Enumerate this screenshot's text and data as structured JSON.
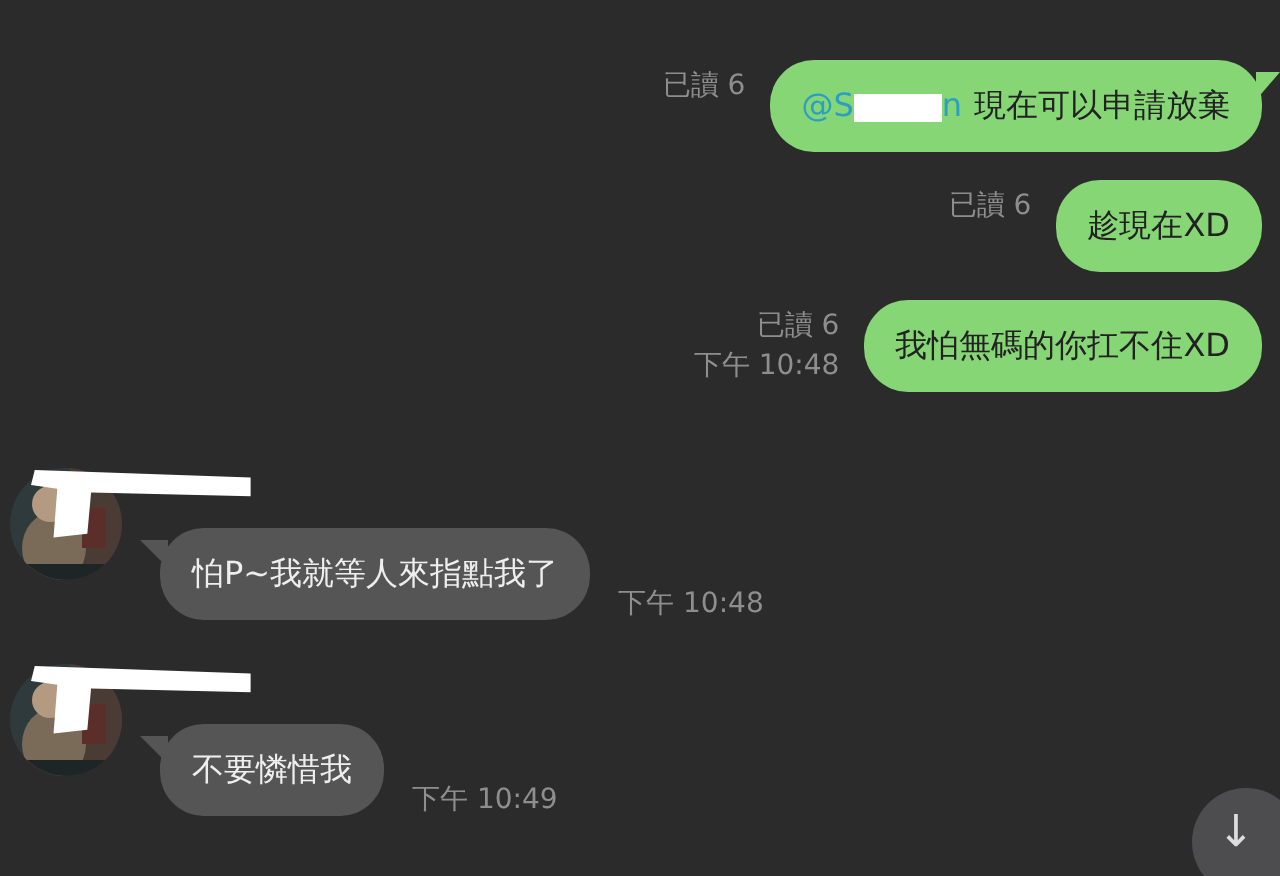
{
  "messages": [
    {
      "kind": "outgoing",
      "mention": [
        "@S",
        "n"
      ],
      "text": "現在可以申請放棄",
      "read": "已讀 6",
      "tail": true
    },
    {
      "kind": "outgoing",
      "text": "趁現在XD",
      "read": "已讀 6",
      "tail": false
    },
    {
      "kind": "outgoing",
      "text": "我怕無碼的你扛不住XD",
      "read": "已讀 6",
      "time": "下午 10:48",
      "tail": false
    },
    {
      "kind": "incoming",
      "text": "怕P~我就等人來指點我了",
      "time": "下午 10:48",
      "tail": true
    },
    {
      "kind": "incoming",
      "text": "不要憐惜我",
      "time": "下午 10:49",
      "tail": true
    }
  ],
  "scroll_button": {
    "icon": "↓"
  }
}
